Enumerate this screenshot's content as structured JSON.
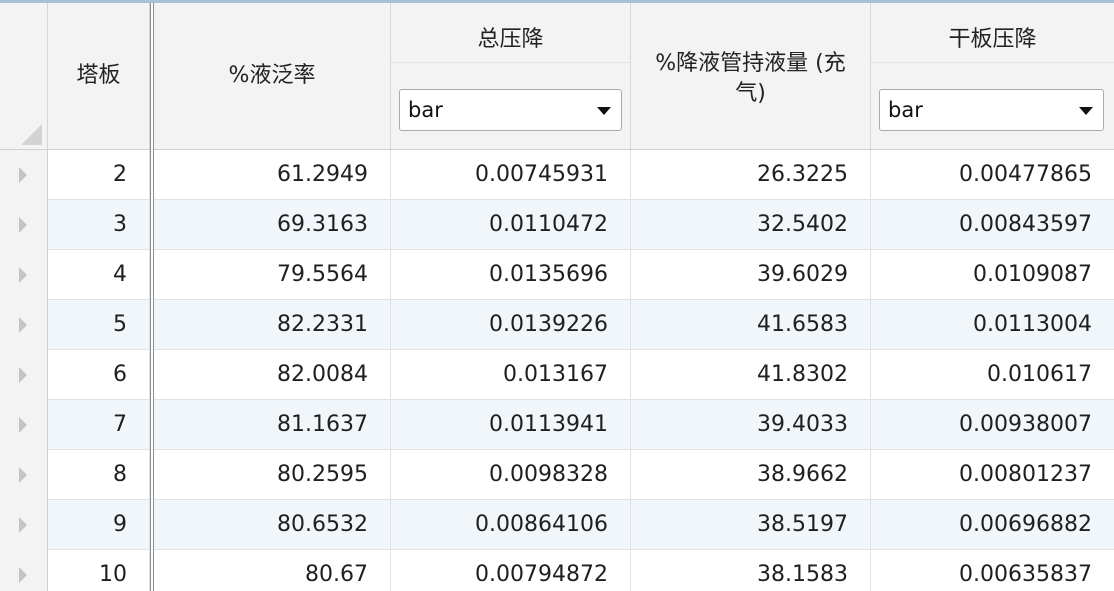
{
  "columns": {
    "tray": "塔板",
    "flood": "%液泛率",
    "total_dp": "总压降",
    "dc_holdup": "%降液管持液量 (充气)",
    "dry_dp": "干板压降"
  },
  "units": {
    "total_dp": "bar",
    "dry_dp": "bar"
  },
  "rows": [
    {
      "tray": "2",
      "flood": "61.2949",
      "total_dp": "0.00745931",
      "dc_holdup": "26.3225",
      "dry_dp": "0.00477865"
    },
    {
      "tray": "3",
      "flood": "69.3163",
      "total_dp": "0.0110472",
      "dc_holdup": "32.5402",
      "dry_dp": "0.00843597"
    },
    {
      "tray": "4",
      "flood": "79.5564",
      "total_dp": "0.0135696",
      "dc_holdup": "39.6029",
      "dry_dp": "0.0109087"
    },
    {
      "tray": "5",
      "flood": "82.2331",
      "total_dp": "0.0139226",
      "dc_holdup": "41.6583",
      "dry_dp": "0.0113004"
    },
    {
      "tray": "6",
      "flood": "82.0084",
      "total_dp": "0.013167",
      "dc_holdup": "41.8302",
      "dry_dp": "0.010617"
    },
    {
      "tray": "7",
      "flood": "81.1637",
      "total_dp": "0.0113941",
      "dc_holdup": "39.4033",
      "dry_dp": "0.00938007"
    },
    {
      "tray": "8",
      "flood": "80.2595",
      "total_dp": "0.0098328",
      "dc_holdup": "38.9662",
      "dry_dp": "0.00801237"
    },
    {
      "tray": "9",
      "flood": "80.6532",
      "total_dp": "0.00864106",
      "dc_holdup": "38.5197",
      "dry_dp": "0.00696882"
    },
    {
      "tray": "10",
      "flood": "80.67",
      "total_dp": "0.00794872",
      "dc_holdup": "38.1583",
      "dry_dp": "0.00635837"
    }
  ]
}
